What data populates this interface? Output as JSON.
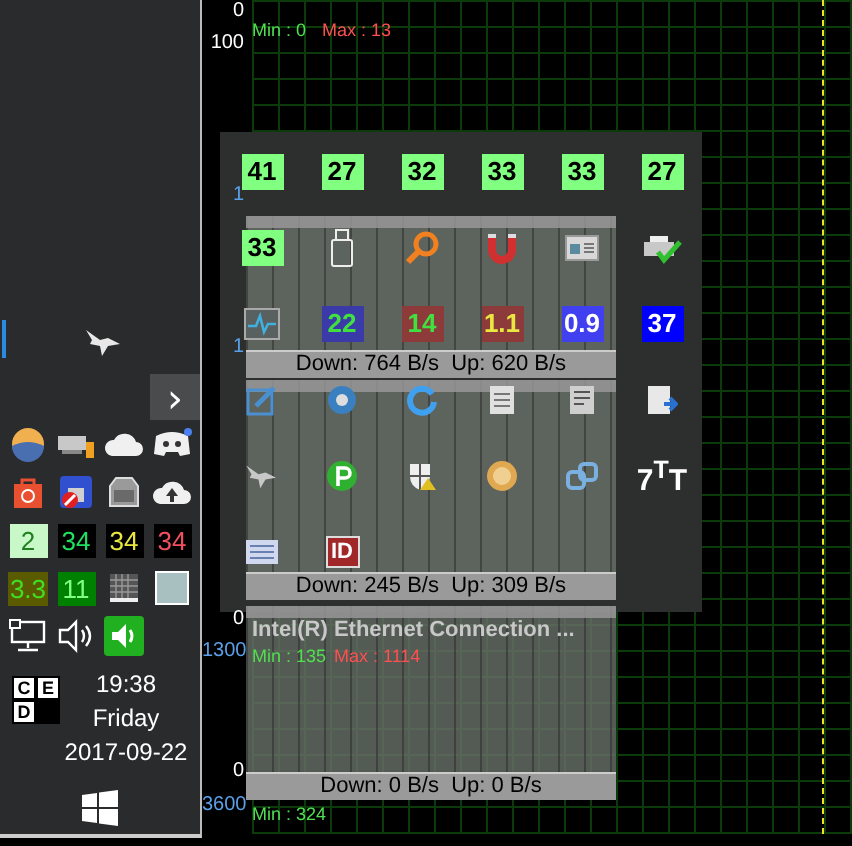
{
  "graph": {
    "axis_labels": [
      {
        "text": "0",
        "kind": "plain"
      },
      {
        "text": "100",
        "kind": "plain"
      },
      {
        "text": "1",
        "kind": "blue"
      },
      {
        "text": "1",
        "kind": "blue"
      },
      {
        "text": "0",
        "kind": "plain"
      },
      {
        "text": "1300",
        "kind": "blue"
      },
      {
        "text": "0",
        "kind": "plain"
      },
      {
        "text": "3600",
        "kind": "blue"
      }
    ],
    "stats": [
      {
        "text": "Min : 0",
        "kind": "min"
      },
      {
        "text": "Max : 13",
        "kind": "max"
      },
      {
        "text": "Min : 135",
        "kind": "min"
      },
      {
        "text": "Max : 1114",
        "kind": "max"
      },
      {
        "text": "Min : 324",
        "kind": "min"
      }
    ]
  },
  "monitor": {
    "panels": [
      {
        "rate": "Down: 764 B/s  Up: 620 B/s"
      },
      {
        "rate": "Down: 245 B/s  Up: 309 B/s"
      },
      {
        "title": "Intel(R) Ethernet Connection ...",
        "rate": "Down: 0 B/s  Up: 0 B/s"
      }
    ]
  },
  "tray_popup": {
    "items": [
      {
        "kind": "darkbadge",
        "text": "41",
        "color": "#80ff80"
      },
      {
        "kind": "darkbadge",
        "text": "27",
        "color": "#80ff80"
      },
      {
        "kind": "darkbadge",
        "text": "32",
        "color": "#80ff80"
      },
      {
        "kind": "darkbadge",
        "text": "33",
        "color": "#80ff80"
      },
      {
        "kind": "darkbadge",
        "text": "33",
        "color": "#80ff80"
      },
      {
        "kind": "darkbadge",
        "text": "27",
        "color": "#80ff80"
      },
      {
        "kind": "darkbadge",
        "text": "33",
        "color": "#80ff80"
      },
      {
        "kind": "usb"
      },
      {
        "kind": "magnifier"
      },
      {
        "kind": "magnet"
      },
      {
        "kind": "window"
      },
      {
        "kind": "printer"
      },
      {
        "kind": "pulse"
      },
      {
        "kind": "greenbadge",
        "text": "22",
        "color": "#3a3aa8"
      },
      {
        "kind": "greenbadge",
        "text": "14",
        "color": "#8c3a3a"
      },
      {
        "kind": "yellowbadge",
        "text": "1.1",
        "color": "#8c3a3a"
      },
      {
        "kind": "whitebadge",
        "text": "0.9",
        "color": "#4040f0"
      },
      {
        "kind": "whitebadge",
        "text": "37",
        "color": "#0000ff"
      },
      {
        "kind": "pencil"
      },
      {
        "kind": "globe"
      },
      {
        "kind": "refresh"
      },
      {
        "kind": "letter"
      },
      {
        "kind": "document"
      },
      {
        "kind": "download"
      },
      {
        "kind": "plane"
      },
      {
        "kind": "pcircle"
      },
      {
        "kind": "shield"
      },
      {
        "kind": "disc"
      },
      {
        "kind": "link"
      },
      {
        "kind": "glyph",
        "text": "7$^{T}$T"
      },
      {
        "kind": "notepad"
      },
      {
        "kind": "idcard",
        "text": "ID"
      }
    ]
  },
  "taskbar": {
    "chevron": "›",
    "tray": [
      {
        "kind": "ball"
      },
      {
        "kind": "netdrive"
      },
      {
        "kind": "cloud"
      },
      {
        "kind": "chat"
      },
      {
        "kind": "bag"
      },
      {
        "kind": "lock"
      },
      {
        "kind": "drive"
      },
      {
        "kind": "upload"
      },
      {
        "kind": "forestbadge",
        "text": "2",
        "color": "#c8f8c8"
      },
      {
        "kind": "mintbadge",
        "text": "34",
        "color": "#000000"
      },
      {
        "kind": "yellowbadge",
        "text": "34",
        "color": "#000000"
      },
      {
        "kind": "pinkbadge",
        "text": "34",
        "color": "#000000"
      },
      {
        "kind": "limebadge",
        "text": "3.3",
        "color": "#5a5a00"
      },
      {
        "kind": "palebadge",
        "text": "11",
        "color": "#008000"
      },
      {
        "kind": "gridicon"
      },
      {
        "kind": "square"
      },
      {
        "kind": "monitor"
      },
      {
        "kind": "speaker"
      },
      {
        "kind": "greenspeaker"
      }
    ],
    "keyboard": [
      "C",
      "E",
      "D"
    ],
    "time": "19:38",
    "day": "Friday",
    "date": "2017-09-22"
  }
}
